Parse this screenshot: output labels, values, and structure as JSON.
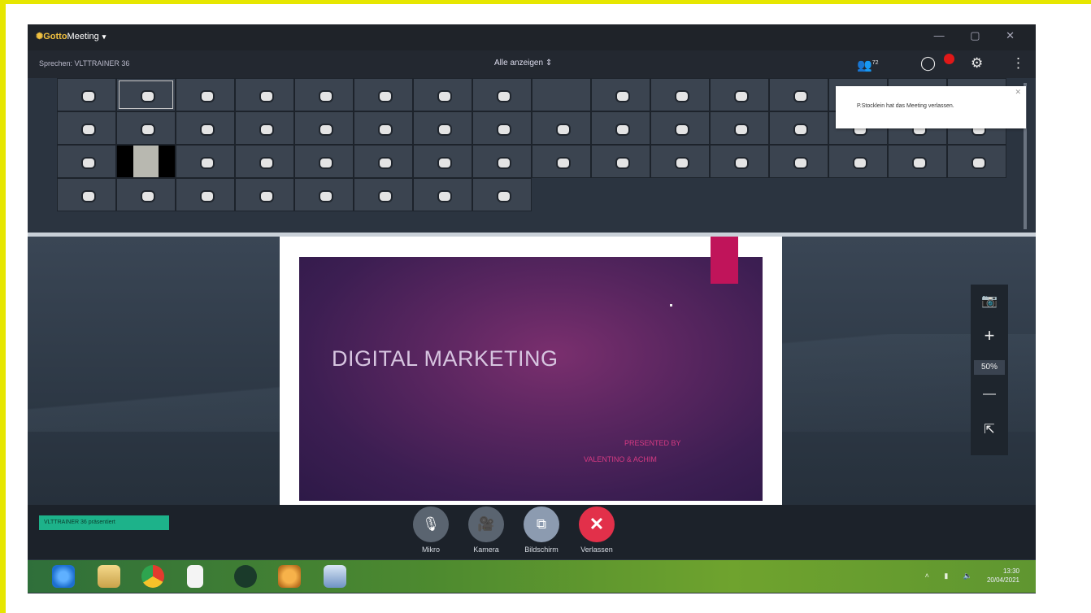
{
  "app": {
    "logo_brand": "Gotto",
    "logo_rest": "Meeting",
    "caret": "▾",
    "window_controls": "— ▢ ✕"
  },
  "infobar": {
    "speaker": "Sprechen: VLTTRAINER 36",
    "view_selector": "Alle anzeigen ⇕",
    "participants_count": "72"
  },
  "notification": {
    "text": "P.Stocklein hat das Meeting verlassen.",
    "close": "✕"
  },
  "slide": {
    "title": "DIGITAL MARKETING",
    "subtitle_1": "PRESENTED BY",
    "subtitle_2": "VALENTINO & ACHIM"
  },
  "zoom": {
    "camera": "📷",
    "plus": "+",
    "percent": "50%",
    "minus": "—",
    "export": "⇱"
  },
  "bottom": {
    "status_pill": "VLTTRAINER 36 präsentiert",
    "controls": [
      {
        "label": "Mikro",
        "icon": "🎙"
      },
      {
        "label": "Kamera",
        "icon": "🎥"
      },
      {
        "label": "Bildschirm",
        "icon": "⧉"
      },
      {
        "label": "Verlassen",
        "icon": "✕"
      }
    ]
  },
  "taskbar": {
    "tray": "˄ ▮ 🔈",
    "time": "13:30",
    "date": "20/04/2021"
  },
  "colors": {
    "accent_green": "#1db28a",
    "leave_red": "#e2304a",
    "notification_badge": "#e01818",
    "slide_accent": "#d63a82"
  }
}
